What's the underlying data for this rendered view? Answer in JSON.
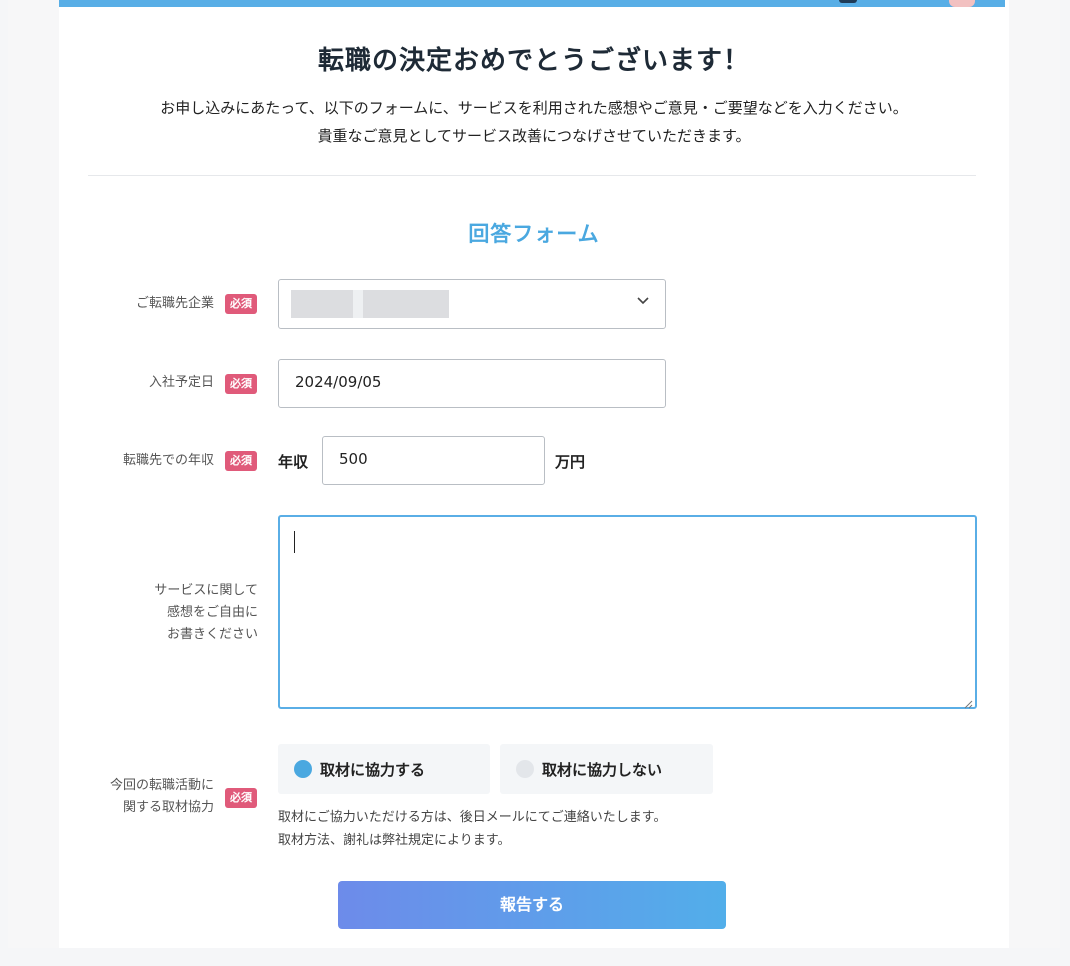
{
  "header": {
    "title": "転職の決定おめでとうございます！",
    "intro_line1": "お申し込みにあたって、以下のフォームに、サービスを利用された感想やご意見・ご要望などを入力ください。",
    "intro_line2": "貴重なご意見としてサービス改善につなげさせていただきます。"
  },
  "form": {
    "title": "回答フォーム",
    "required_badge": "必須",
    "company": {
      "label": "ご転職先企業",
      "chevron_icon": "chevron-down-icon"
    },
    "join_date": {
      "label": "入社予定日",
      "value": "2024/09/05"
    },
    "salary": {
      "label": "転職先での年収",
      "prefix": "年収",
      "value": "500",
      "unit": "万円"
    },
    "feedback": {
      "label_line1": "サービスに関して",
      "label_line2": "感想をご自由に",
      "label_line3": "お書きください",
      "value": ""
    },
    "interview": {
      "label_line1": "今回の転職活動に",
      "label_line2": "関する取材協力",
      "options": [
        {
          "label": "取材に協力する",
          "selected": true
        },
        {
          "label": "取材に協力しない",
          "selected": false
        }
      ],
      "note_line1": "取材にご協力いただける方は、後日メールにてご連絡いたします。",
      "note_line2": "取材方法、謝礼は弊社規定によります。"
    },
    "submit_label": "報告する"
  },
  "colors": {
    "accent": "#4aa8e0",
    "required": "#e05a7a",
    "radio_selected": "#4aa8e0",
    "radio_unselected": "#e3e6ea"
  }
}
